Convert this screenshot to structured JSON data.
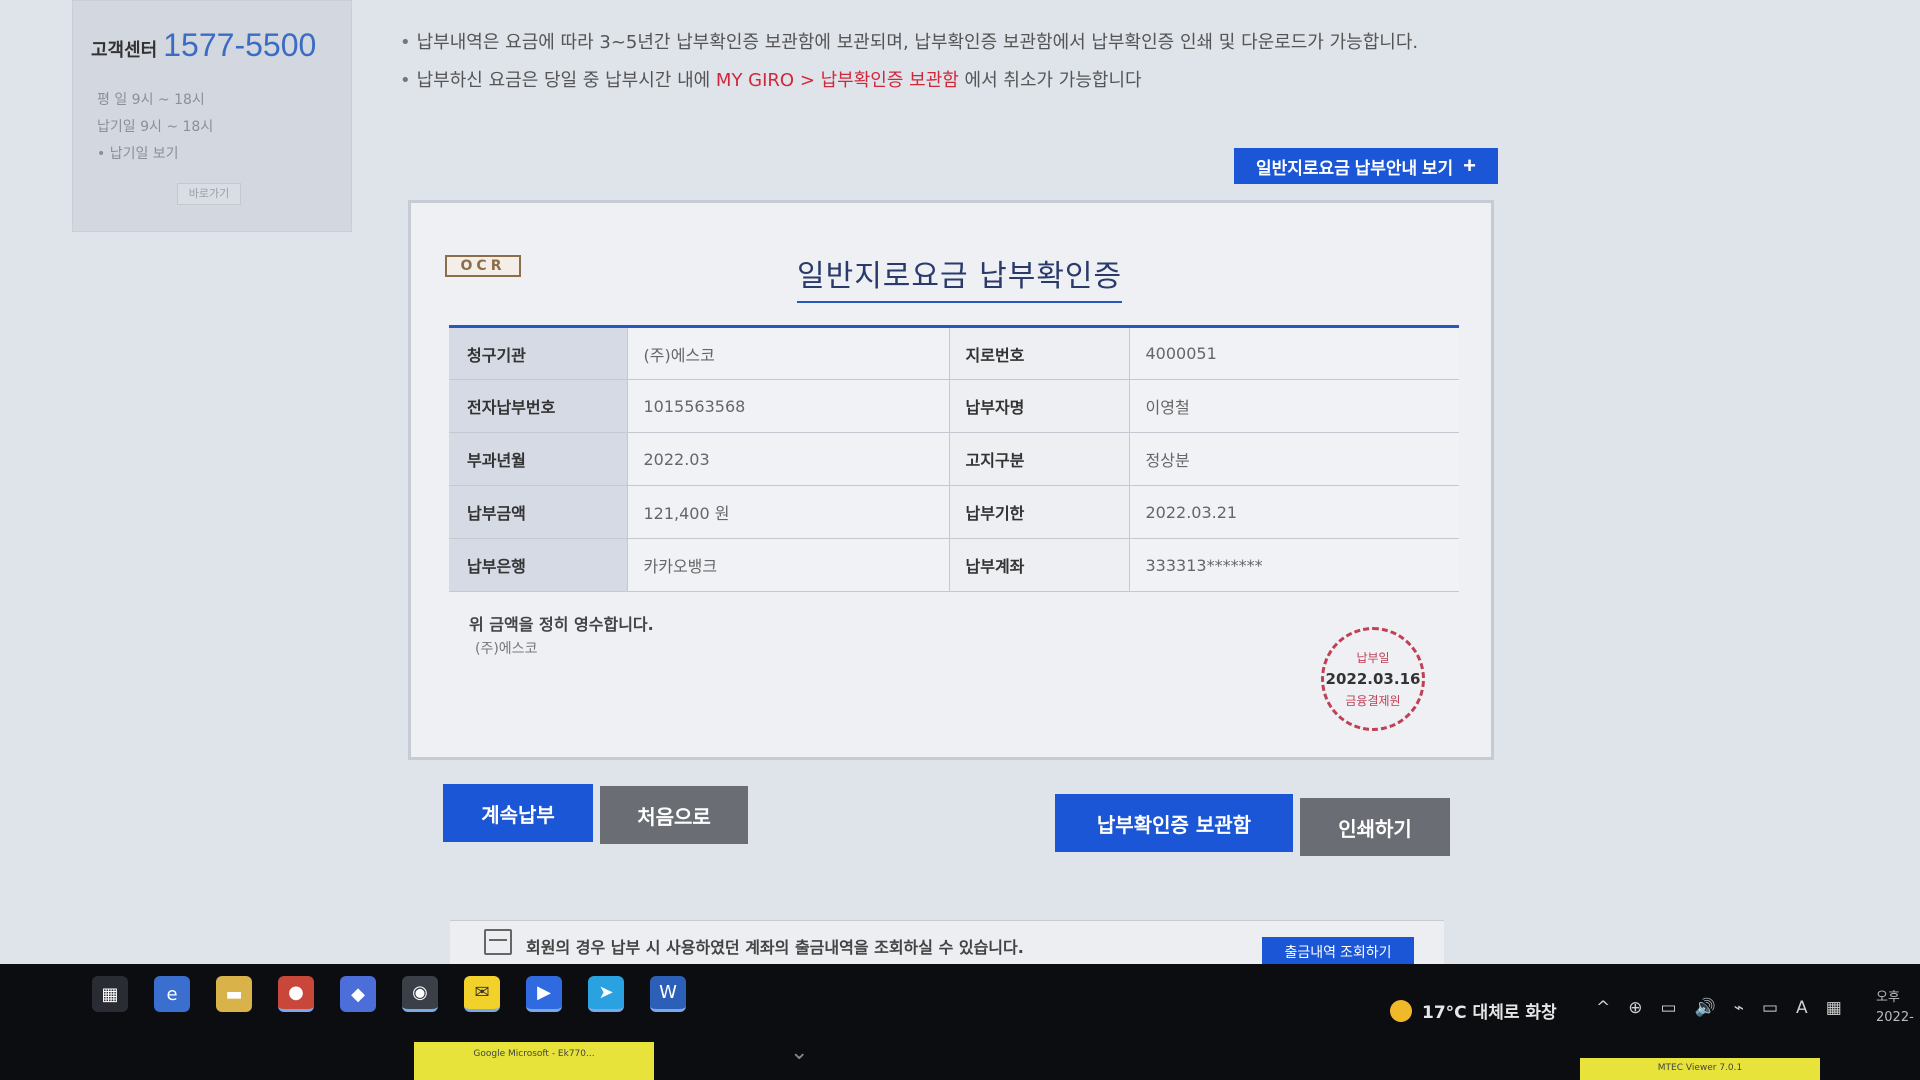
{
  "sidebar": {
    "cs_label": "고객센터",
    "cs_phone": "1577-5500",
    "hours": [
      "평    일  9시 ~ 18시",
      "납기일  9시 ~ 18시",
      "• 납기일 보기"
    ],
    "more_label": "바로가기"
  },
  "notices": {
    "line1": "납부내역은 요금에 따라 3~5년간 납부확인증 보관함에 보관되며, 납부확인증 보관함에서 납부확인증 인쇄 및 다운로드가 가능합니다.",
    "line2_pre": "납부하신 요금은 당일 중 납부시간 내에 ",
    "line2_link": "MY GIRO > 납부확인증 보관함",
    "line2_post": " 에서 취소가 가능합니다"
  },
  "guide_button": {
    "label": "일반지로요금 납부안내 보기",
    "plus": "+"
  },
  "receipt": {
    "ocr_label": "OCR",
    "title": "일반지로요금 납부확인증",
    "rows": [
      {
        "k1": "청구기관",
        "v1": "(주)에스코",
        "k2": "지로번호",
        "v2": "4000051"
      },
      {
        "k1": "전자납부번호",
        "v1": "1015563568",
        "k2": "납부자명",
        "v2": "이영철"
      },
      {
        "k1": "부과년월",
        "v1": "2022.03",
        "k2": "고지구분",
        "v2": "정상분"
      },
      {
        "k1": "납부금액",
        "v1": "121,400 원",
        "k2": "납부기한",
        "v2": "2022.03.21"
      },
      {
        "k1": "납부은행",
        "v1": "카카오뱅크",
        "k2": "납부계좌",
        "v2": "333313*******"
      }
    ],
    "confirm_text": "위 금액을 정히 영수합니다.",
    "confirm_org": "(주)에스코",
    "stamp": {
      "top": "납부일",
      "date": "2022.03.16",
      "bottom": "금융결제원"
    }
  },
  "actions": {
    "continue": "계속납부",
    "first": "처음으로",
    "vault": "납부확인증 보관함",
    "print": "인쇄하기"
  },
  "info_bar": {
    "text": "회원의 경우 납부 시 사용하였던 계좌의 출금내역을 조회하실 수 있습니다.",
    "button": "출금내역 조회하기"
  },
  "taskbar": {
    "weather": "17°C  대체로 화창",
    "tray_icons": [
      "^",
      "⊕",
      "▭",
      "🔊",
      "⌁",
      "▭",
      "A",
      "▦"
    ],
    "time_line1": "오후",
    "time_line2": "2022-",
    "tab1": "Google\nMicrosoft - Ek770...",
    "tab2": "MTEC Viewer 7.0.1"
  }
}
